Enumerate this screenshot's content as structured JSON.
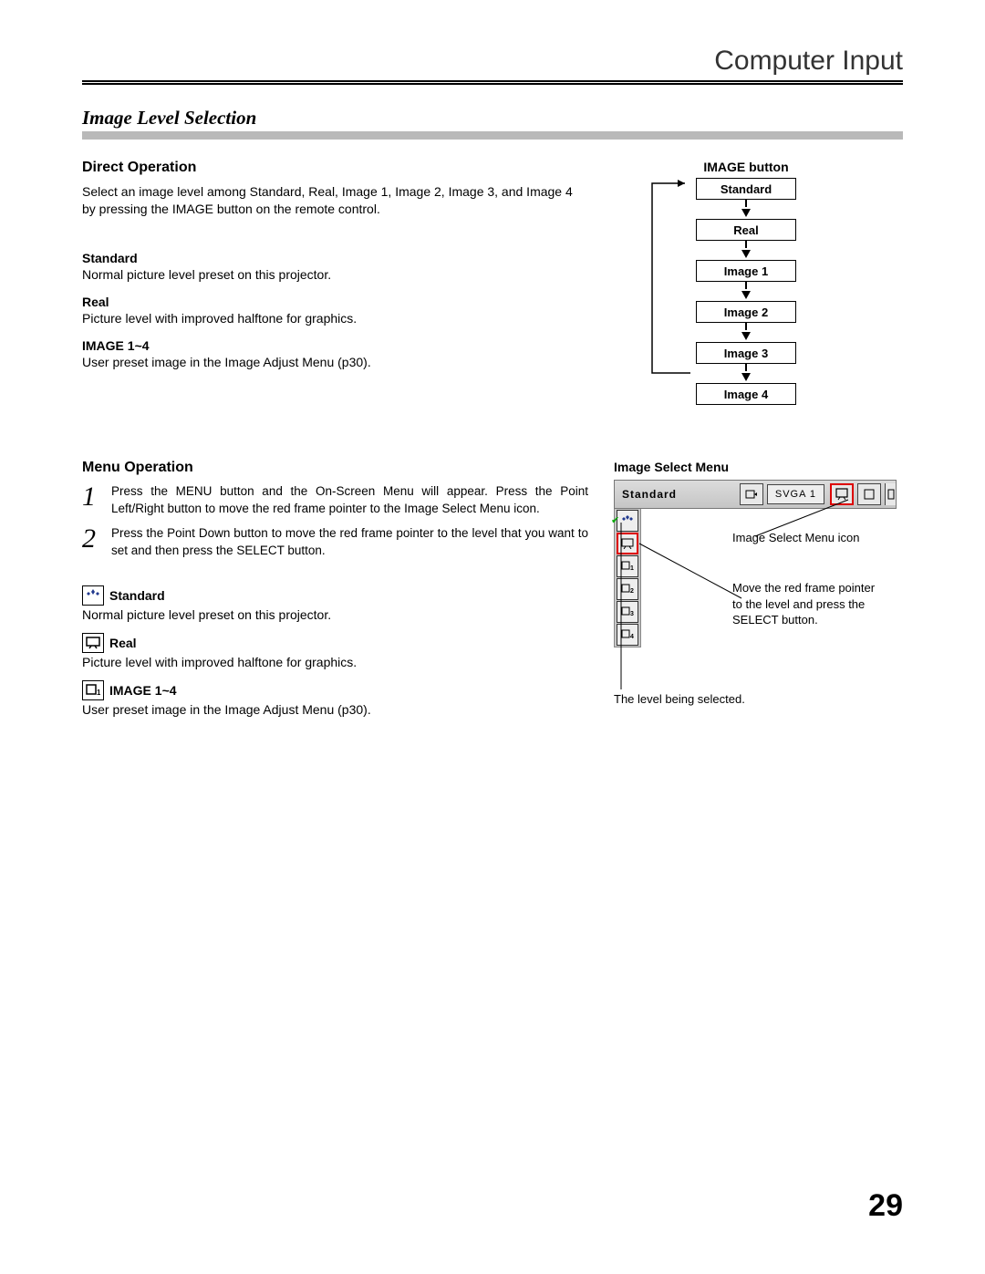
{
  "header": {
    "title": "Computer Input"
  },
  "section": {
    "title": "Image Level Selection"
  },
  "direct": {
    "heading": "Direct Operation",
    "intro": "Select an image level among Standard, Real, Image 1, Image 2, Image 3, and Image 4 by pressing the IMAGE button on the remote control.",
    "items": [
      {
        "term": "Standard",
        "def": "Normal picture level preset on this projector."
      },
      {
        "term": "Real",
        "def": "Picture level with improved halftone for graphics."
      },
      {
        "term": "IMAGE 1~4",
        "def": "User preset image in the Image Adjust Menu (p30)."
      }
    ]
  },
  "diagram": {
    "title": "IMAGE button",
    "levels": [
      "Standard",
      "Real",
      "Image 1",
      "Image 2",
      "Image 3",
      "Image 4"
    ]
  },
  "menu": {
    "heading": "Menu Operation",
    "steps": [
      {
        "n": "1",
        "text": "Press the MENU button and the On-Screen Menu will appear. Press the Point Left/Right button to move the red frame pointer to the Image Select Menu icon."
      },
      {
        "n": "2",
        "text": "Press the Point Down button to move the red frame pointer to the level that you want to set and then press the SELECT button."
      }
    ],
    "modes": [
      {
        "icon": "sparkle-icon",
        "label": "Standard",
        "def": "Normal picture level preset on this projector."
      },
      {
        "icon": "screen-icon",
        "label": "Real",
        "def": "Picture level with improved halftone for graphics."
      },
      {
        "icon": "preset1-icon",
        "label": "IMAGE 1~4",
        "def": "User preset image in the Image Adjust Menu (p30)."
      }
    ]
  },
  "ism": {
    "title": "Image Select Menu",
    "current_label": "Standard",
    "svga_label": "SVGA 1",
    "side_numbers": [
      "1",
      "2",
      "3",
      "4"
    ],
    "callout1": "Image Select Menu icon",
    "callout2": "Move the red frame pointer to the level and press the SELECT button.",
    "callout3": "The level being selected."
  },
  "page_number": "29"
}
